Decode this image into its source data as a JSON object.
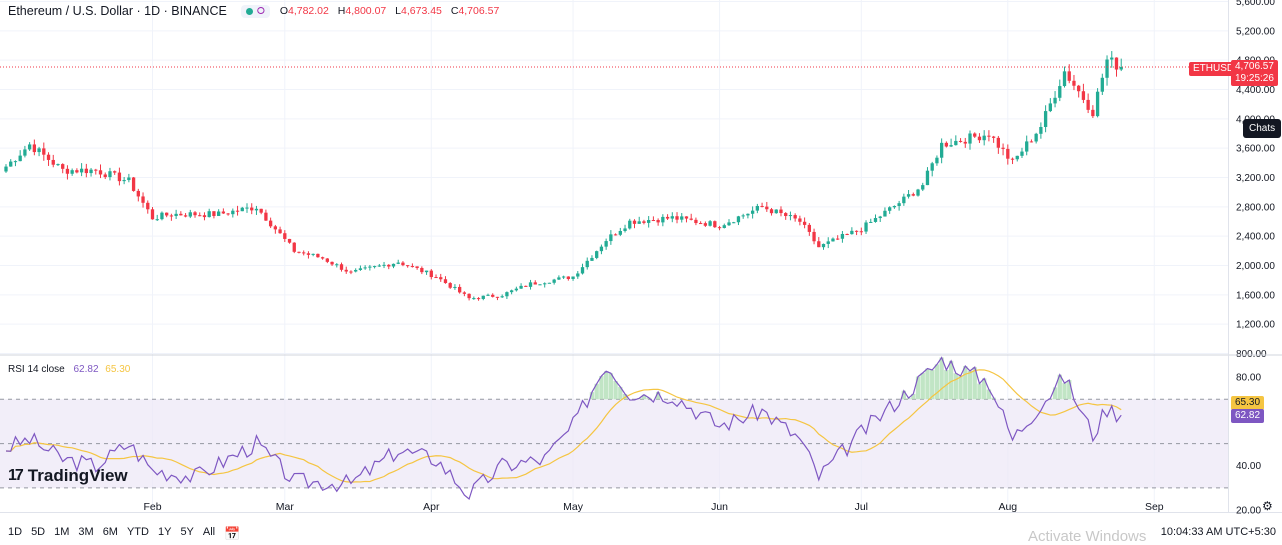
{
  "header": {
    "title": "Ethereum / U.S. Dollar · 1D · BINANCE",
    "ohlc": [
      {
        "k": "O",
        "v": "4,782.02"
      },
      {
        "k": "H",
        "v": "4,800.07"
      },
      {
        "k": "L",
        "v": "4,673.45"
      },
      {
        "k": "C",
        "v": "4,706.57"
      }
    ]
  },
  "price_tag": {
    "symbol": "ETHUSD",
    "price": "4,706.57",
    "countdown": "19:25:26"
  },
  "chats_label": "Chats",
  "rsi": {
    "label": "RSI 14 close",
    "value": "62.82",
    "ma": "65.30"
  },
  "toolbar": [
    "1D",
    "5D",
    "1M",
    "3M",
    "6M",
    "YTD",
    "1Y",
    "5Y",
    "All"
  ],
  "clock": "10:04:33 AM UTC+5:30",
  "watermark": "Activate Windows",
  "logo": "TradingView",
  "colors": {
    "up": "#22ab94",
    "down": "#f23645",
    "rsi": "#7e57c2",
    "rsi_ma": "#f5c542",
    "band": "#ede7f6"
  },
  "chart_data": [
    {
      "type": "candlestick",
      "title": "Ethereum / U.S. Dollar · 1D · BINANCE",
      "ylim": [
        800,
        5600
      ],
      "yticks": [
        800,
        1200,
        1600,
        2000,
        2400,
        2800,
        3200,
        3600,
        4000,
        4400,
        4800,
        5200,
        5600
      ],
      "ytick_labels": [
        "800.00",
        "1,200.00",
        "1,600.00",
        "2,000.00",
        "2,400.00",
        "2,800.00",
        "3,200.00",
        "3,600.00",
        "4,000.00",
        "4,400.00",
        "4,800.00",
        "5,200.00",
        "5,600.00"
      ],
      "xticks": [
        "Feb",
        "Mar",
        "Apr",
        "May",
        "Jun",
        "Jul",
        "Aug",
        "Sep"
      ],
      "last_price": 4706.57,
      "series_keypoints_close": [
        {
          "date": "Jan 01",
          "close": 3350
        },
        {
          "date": "Jan 06",
          "close": 3650
        },
        {
          "date": "Jan 13",
          "close": 3300
        },
        {
          "date": "Jan 20",
          "close": 3300
        },
        {
          "date": "Jan 27",
          "close": 3150
        },
        {
          "date": "Feb 01",
          "close": 2650
        },
        {
          "date": "Feb 05",
          "close": 2700
        },
        {
          "date": "Feb 15",
          "close": 2700
        },
        {
          "date": "Feb 23",
          "close": 2800
        },
        {
          "date": "Mar 03",
          "close": 2200
        },
        {
          "date": "Mar 09",
          "close": 2100
        },
        {
          "date": "Mar 15",
          "close": 1900
        },
        {
          "date": "Mar 25",
          "close": 2050
        },
        {
          "date": "Apr 02",
          "close": 1850
        },
        {
          "date": "Apr 09",
          "close": 1550
        },
        {
          "date": "Apr 16",
          "close": 1600
        },
        {
          "date": "Apr 22",
          "close": 1750
        },
        {
          "date": "May 01",
          "close": 1850
        },
        {
          "date": "May 08",
          "close": 2350
        },
        {
          "date": "May 13",
          "close": 2600
        },
        {
          "date": "May 22",
          "close": 2650
        },
        {
          "date": "Jun 01",
          "close": 2550
        },
        {
          "date": "Jun 10",
          "close": 2800
        },
        {
          "date": "Jun 18",
          "close": 2600
        },
        {
          "date": "Jun 22",
          "close": 2250
        },
        {
          "date": "Jul 01",
          "close": 2500
        },
        {
          "date": "Jul 10",
          "close": 2900
        },
        {
          "date": "Jul 14",
          "close": 3100
        },
        {
          "date": "Jul 18",
          "close": 3650
        },
        {
          "date": "Jul 28",
          "close": 3800
        },
        {
          "date": "Aug 02",
          "close": 3400
        },
        {
          "date": "Aug 08",
          "close": 3900
        },
        {
          "date": "Aug 13",
          "close": 4650
        },
        {
          "date": "Aug 19",
          "close": 4100
        },
        {
          "date": "Aug 22",
          "close": 4800
        },
        {
          "date": "Aug 25",
          "close": 4706.57
        }
      ]
    },
    {
      "type": "line",
      "title": "RSI 14 close",
      "ylim": [
        20,
        90
      ],
      "yticks": [
        20,
        40,
        80
      ],
      "ytick_labels": [
        "20.00",
        "40.00",
        "80.00"
      ],
      "bands": [
        30,
        50,
        70
      ],
      "last_rsi": 62.82,
      "last_ma": 65.3,
      "rsi_keypoints": [
        {
          "date": "Jan 01",
          "value": 48
        },
        {
          "date": "Jan 06",
          "value": 52
        },
        {
          "date": "Jan 13",
          "value": 43
        },
        {
          "date": "Jan 20",
          "value": 40
        },
        {
          "date": "Jan 27",
          "value": 50
        },
        {
          "date": "Feb 01",
          "value": 38
        },
        {
          "date": "Feb 10",
          "value": 35
        },
        {
          "date": "Feb 23",
          "value": 50
        },
        {
          "date": "Mar 03",
          "value": 33
        },
        {
          "date": "Mar 15",
          "value": 32
        },
        {
          "date": "Mar 25",
          "value": 47
        },
        {
          "date": "Apr 02",
          "value": 43
        },
        {
          "date": "Apr 09",
          "value": 27
        },
        {
          "date": "Apr 16",
          "value": 40
        },
        {
          "date": "Apr 25",
          "value": 43
        },
        {
          "date": "May 01",
          "value": 58
        },
        {
          "date": "May 08",
          "value": 86
        },
        {
          "date": "May 13",
          "value": 73
        },
        {
          "date": "May 22",
          "value": 72
        },
        {
          "date": "Jun 01",
          "value": 58
        },
        {
          "date": "Jun 10",
          "value": 65
        },
        {
          "date": "Jun 18",
          "value": 52
        },
        {
          "date": "Jun 22",
          "value": 35
        },
        {
          "date": "Jul 01",
          "value": 55
        },
        {
          "date": "Jul 10",
          "value": 72
        },
        {
          "date": "Jul 14",
          "value": 80
        },
        {
          "date": "Jul 18",
          "value": 88
        },
        {
          "date": "Jul 28",
          "value": 78
        },
        {
          "date": "Aug 02",
          "value": 52
        },
        {
          "date": "Aug 08",
          "value": 68
        },
        {
          "date": "Aug 13",
          "value": 80
        },
        {
          "date": "Aug 19",
          "value": 54
        },
        {
          "date": "Aug 22",
          "value": 66
        },
        {
          "date": "Aug 25",
          "value": 62.82
        }
      ]
    }
  ]
}
